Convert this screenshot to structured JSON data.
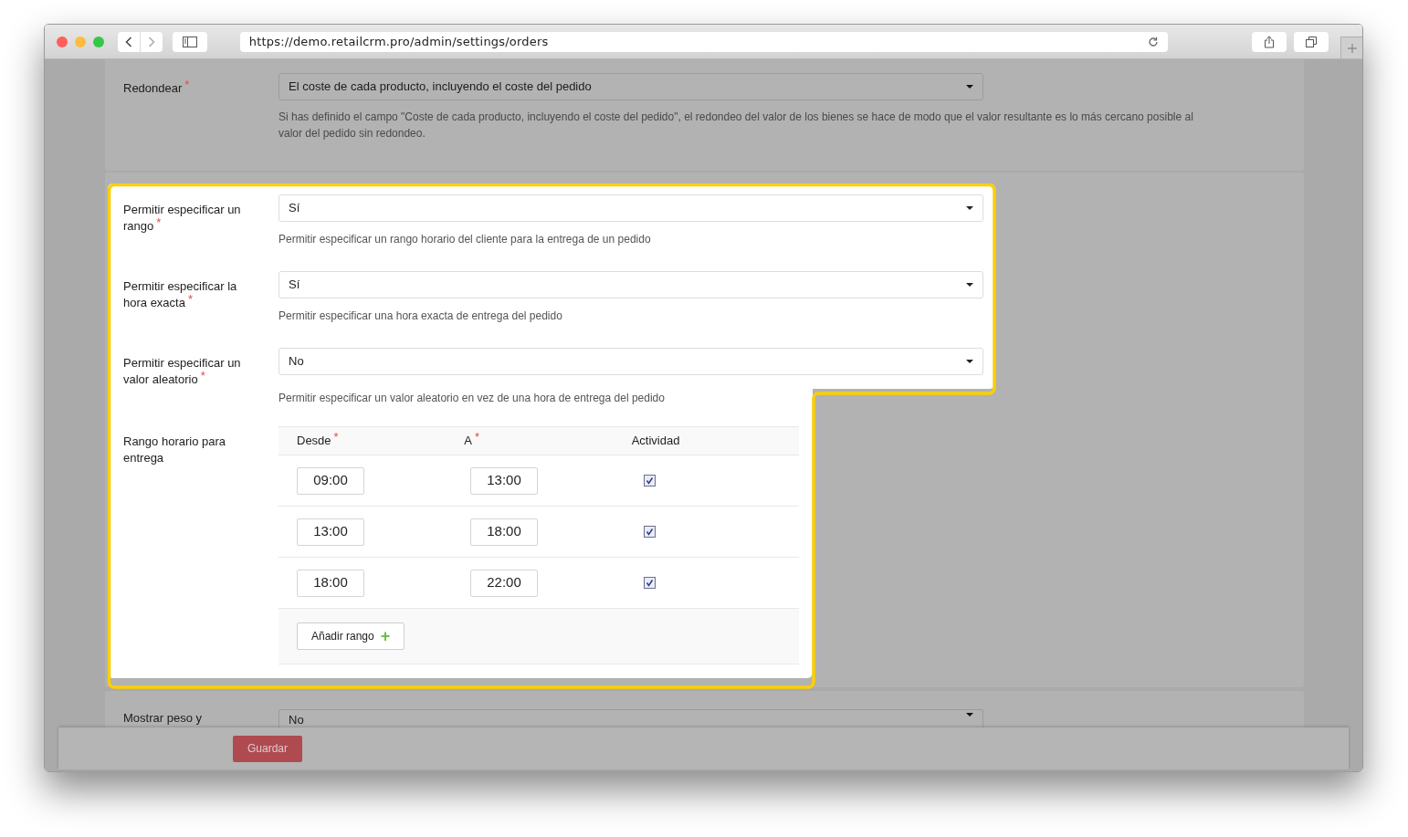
{
  "browser": {
    "url": "https://demo.retailcrm.pro/admin/settings/orders"
  },
  "rounding": {
    "label": "Redondear",
    "mark": "*",
    "value": "El coste de cada producto, incluyendo el coste del pedido",
    "help": "Si has definido el campo \"Coste de cada producto, incluyendo el coste del pedido\", el redondeo del valor de los bienes se hace de modo que el valor resultante es lo más cercano posible al valor del pedido sin redondeo."
  },
  "fields": [
    {
      "label": "Permitir especificar un rango",
      "mark": "*",
      "value": "Sí",
      "help": "Permitir especificar un rango horario del cliente para la entrega de un pedido"
    },
    {
      "label": "Permitir especificar la hora exacta",
      "mark": "*",
      "value": "Sí",
      "help": "Permitir especificar una hora exacta de entrega del pedido"
    },
    {
      "label": "Permitir especificar un valor aleatorio",
      "mark": "*",
      "value": "No",
      "help": "Permitir especificar un valor aleatorio en vez de una hora de entrega del pedido"
    }
  ],
  "time_ranges": {
    "label": "Rango horario para entrega",
    "columns": [
      {
        "label": "Desde",
        "mark": "*"
      },
      {
        "label": "A",
        "mark": "*"
      },
      {
        "label": "Actividad"
      }
    ],
    "rows": [
      {
        "from": "09:00",
        "to": "13:00",
        "checked": true
      },
      {
        "from": "13:00",
        "to": "18:00",
        "checked": true
      },
      {
        "from": "18:00",
        "to": "22:00",
        "checked": true
      }
    ],
    "add_button": "Añadir rango",
    "add_icon": "+"
  },
  "next_field": {
    "label": "Mostrar peso y",
    "value": "No"
  },
  "save_button": "Guardar"
}
